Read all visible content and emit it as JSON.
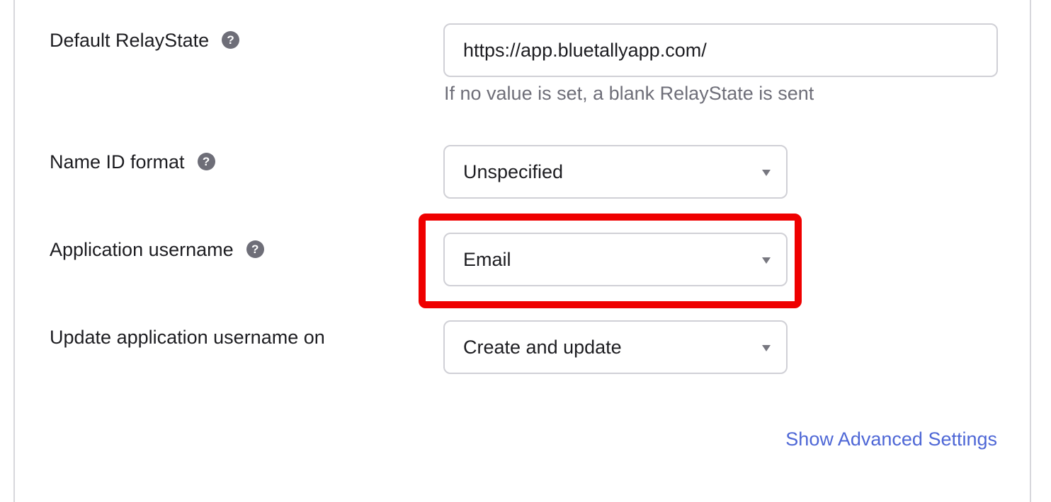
{
  "fields": {
    "relay_state": {
      "label": "Default RelayState",
      "help_icon": "?",
      "value": "https://app.bluetallyapp.com/",
      "hint": "If no value is set, a blank RelayState is sent"
    },
    "name_id_format": {
      "label": "Name ID format",
      "help_icon": "?",
      "selected": "Unspecified"
    },
    "app_username": {
      "label": "Application username",
      "help_icon": "?",
      "selected": "Email"
    },
    "update_username_on": {
      "label": "Update application username on",
      "selected": "Create and update"
    }
  },
  "advanced_link": "Show Advanced Settings",
  "colors": {
    "highlight": "#ef0000",
    "link": "#4e67d6",
    "help_icon_bg": "#6e6e78"
  },
  "icons": {
    "help": "question-circle-icon",
    "dropdown": "caret-down-icon"
  }
}
